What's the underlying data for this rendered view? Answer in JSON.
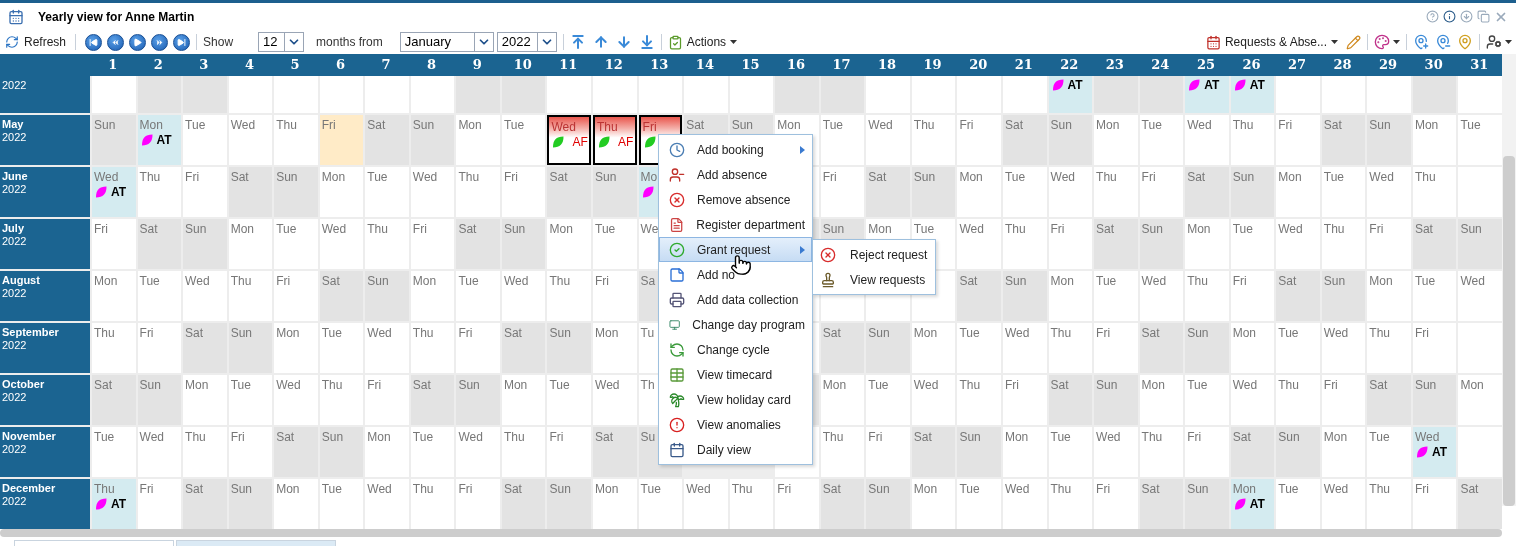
{
  "window": {
    "title": "Yearly view for Anne Martin"
  },
  "toolbar": {
    "refresh": "Refresh",
    "show": "Show",
    "months_count": "12",
    "months_from": "months from",
    "start_month": "January",
    "start_year": "2022",
    "actions": "Actions",
    "requests": "Requests & Abse..."
  },
  "day_numbers": [
    "1",
    "2",
    "3",
    "4",
    "5",
    "6",
    "7",
    "8",
    "9",
    "10",
    "11",
    "12",
    "13",
    "14",
    "15",
    "16",
    "17",
    "18",
    "19",
    "20",
    "21",
    "22",
    "23",
    "24",
    "25",
    "26",
    "27",
    "28",
    "29",
    "30",
    "31"
  ],
  "months": [
    {
      "year": "2022",
      "cells": [
        {
          "kind": "weekday"
        },
        {
          "kind": "weekend"
        },
        {
          "kind": "weekend"
        },
        {
          "kind": "weekday"
        },
        {
          "kind": "weekday"
        },
        {
          "kind": "weekday"
        },
        {
          "kind": "weekday"
        },
        {
          "kind": "weekday"
        },
        {
          "kind": "weekend"
        },
        {
          "kind": "weekend"
        },
        {
          "kind": "weekday"
        },
        {
          "kind": "weekday"
        },
        {
          "kind": "weekday"
        },
        {
          "kind": "weekday"
        },
        {
          "kind": "weekday"
        },
        {
          "kind": "weekend"
        },
        {
          "kind": "weekend"
        },
        {
          "kind": "weekday"
        },
        {
          "kind": "weekday"
        },
        {
          "kind": "weekday"
        },
        {
          "kind": "weekday"
        },
        {
          "kind": "absence",
          "badge": {
            "label": "AT",
            "color": "#ff00ff"
          }
        },
        {
          "kind": "weekend"
        },
        {
          "kind": "weekend"
        },
        {
          "kind": "absence",
          "badge": {
            "label": "AT",
            "color": "#ff00ff"
          }
        },
        {
          "kind": "absence",
          "badge": {
            "label": "AT",
            "color": "#ff00ff"
          }
        },
        {
          "kind": "weekday"
        },
        {
          "kind": "weekday"
        },
        {
          "kind": "weekday"
        },
        {
          "kind": "weekend"
        },
        {
          "kind": "empty"
        }
      ]
    },
    {
      "month": "May",
      "year": "2022",
      "cells": [
        {
          "day": "Sun",
          "kind": "weekend"
        },
        {
          "day": "Mon",
          "kind": "absence",
          "badge": {
            "label": "AT",
            "color": "#ff00ff"
          }
        },
        {
          "day": "Tue",
          "kind": "weekday"
        },
        {
          "day": "Wed",
          "kind": "weekday"
        },
        {
          "day": "Thu",
          "kind": "weekday"
        },
        {
          "day": "Fri",
          "kind": "holiday"
        },
        {
          "day": "Sat",
          "kind": "weekend"
        },
        {
          "day": "Sun",
          "kind": "weekend"
        },
        {
          "day": "Mon",
          "kind": "weekday"
        },
        {
          "day": "Tue",
          "kind": "weekday"
        },
        {
          "day": "Wed",
          "kind": "request",
          "badge": {
            "label": "AF",
            "color": "#22cc22"
          }
        },
        {
          "day": "Thu",
          "kind": "request",
          "badge": {
            "label": "AF",
            "color": "#22cc22"
          }
        },
        {
          "day": "Fri",
          "kind": "request",
          "badge": {
            "color": "#22cc22"
          }
        },
        {
          "day": "Sat",
          "kind": "weekend"
        },
        {
          "day": "Sun",
          "kind": "weekend"
        },
        {
          "day": "Mon",
          "kind": "weekday"
        },
        {
          "day": "Tue",
          "kind": "weekday"
        },
        {
          "day": "Wed",
          "kind": "weekday"
        },
        {
          "day": "Thu",
          "kind": "weekday"
        },
        {
          "day": "Fri",
          "kind": "weekday"
        },
        {
          "day": "Sat",
          "kind": "weekend"
        },
        {
          "day": "Sun",
          "kind": "weekend"
        },
        {
          "day": "Mon",
          "kind": "weekday"
        },
        {
          "day": "Tue",
          "kind": "weekday"
        },
        {
          "day": "Wed",
          "kind": "weekday"
        },
        {
          "day": "Thu",
          "kind": "weekday"
        },
        {
          "day": "Fri",
          "kind": "weekday"
        },
        {
          "day": "Sat",
          "kind": "weekend"
        },
        {
          "day": "Sun",
          "kind": "weekend"
        },
        {
          "day": "Mon",
          "kind": "weekday"
        },
        {
          "day": "Tue",
          "kind": "weekday"
        }
      ]
    },
    {
      "month": "June",
      "year": "2022",
      "cells": [
        {
          "day": "Wed",
          "kind": "absence",
          "badge": {
            "label": "AT",
            "color": "#ff00ff"
          }
        },
        {
          "day": "Thu",
          "kind": "weekday"
        },
        {
          "day": "Fri",
          "kind": "weekday"
        },
        {
          "day": "Sat",
          "kind": "weekend"
        },
        {
          "day": "Sun",
          "kind": "weekend"
        },
        {
          "day": "Mon",
          "kind": "weekday"
        },
        {
          "day": "Tue",
          "kind": "weekday"
        },
        {
          "day": "Wed",
          "kind": "weekday"
        },
        {
          "day": "Thu",
          "kind": "weekday"
        },
        {
          "day": "Fri",
          "kind": "weekday"
        },
        {
          "day": "Sat",
          "kind": "weekend"
        },
        {
          "day": "Sun",
          "kind": "weekend"
        },
        {
          "day": "Mo",
          "kind": "absence",
          "badge": {
            "color": "#ff00ff"
          }
        },
        {
          "kind": "covered"
        },
        {
          "kind": "covered"
        },
        {
          "kind": "weekday"
        },
        {
          "day": "Fri",
          "kind": "weekday"
        },
        {
          "day": "Sat",
          "kind": "weekend"
        },
        {
          "day": "Sun",
          "kind": "weekend"
        },
        {
          "day": "Mon",
          "kind": "weekday"
        },
        {
          "day": "Tue",
          "kind": "weekday"
        },
        {
          "day": "Wed",
          "kind": "weekday"
        },
        {
          "day": "Thu",
          "kind": "weekday"
        },
        {
          "day": "Fri",
          "kind": "weekday"
        },
        {
          "day": "Sat",
          "kind": "weekend"
        },
        {
          "day": "Sun",
          "kind": "weekend"
        },
        {
          "day": "Mon",
          "kind": "weekday"
        },
        {
          "day": "Tue",
          "kind": "weekday"
        },
        {
          "day": "Wed",
          "kind": "weekday"
        },
        {
          "day": "Thu",
          "kind": "weekday"
        },
        {
          "kind": "empty"
        }
      ]
    },
    {
      "month": "July",
      "year": "2022",
      "cells": [
        {
          "day": "Fri",
          "kind": "weekday"
        },
        {
          "day": "Sat",
          "kind": "weekend"
        },
        {
          "day": "Sun",
          "kind": "weekend"
        },
        {
          "day": "Mon",
          "kind": "weekday"
        },
        {
          "day": "Tue",
          "kind": "weekday"
        },
        {
          "day": "Wed",
          "kind": "weekday"
        },
        {
          "day": "Thu",
          "kind": "weekday"
        },
        {
          "day": "Fri",
          "kind": "weekday"
        },
        {
          "day": "Sat",
          "kind": "weekend"
        },
        {
          "day": "Sun",
          "kind": "weekend"
        },
        {
          "day": "Mon",
          "kind": "weekday"
        },
        {
          "day": "Tue",
          "kind": "weekday"
        },
        {
          "day": "We",
          "kind": "weekday"
        },
        {
          "kind": "covered"
        },
        {
          "kind": "covered"
        },
        {
          "kind": "weekend"
        },
        {
          "day": "Sun",
          "kind": "weekend"
        },
        {
          "day": "Mon",
          "kind": "weekday"
        },
        {
          "day": "Tue",
          "kind": "weekday"
        },
        {
          "day": "Wed",
          "kind": "weekday"
        },
        {
          "day": "Thu",
          "kind": "weekday"
        },
        {
          "day": "Fri",
          "kind": "weekday"
        },
        {
          "day": "Sat",
          "kind": "weekend"
        },
        {
          "day": "Sun",
          "kind": "weekend"
        },
        {
          "day": "Mon",
          "kind": "weekday"
        },
        {
          "day": "Tue",
          "kind": "weekday"
        },
        {
          "day": "Wed",
          "kind": "weekday"
        },
        {
          "day": "Thu",
          "kind": "weekday"
        },
        {
          "day": "Fri",
          "kind": "weekday"
        },
        {
          "day": "Sat",
          "kind": "weekend"
        },
        {
          "day": "Sun",
          "kind": "weekend"
        }
      ]
    },
    {
      "month": "August",
      "year": "2022",
      "cells": [
        {
          "day": "Mon",
          "kind": "weekday"
        },
        {
          "day": "Tue",
          "kind": "weekday"
        },
        {
          "day": "Wed",
          "kind": "weekday"
        },
        {
          "day": "Thu",
          "kind": "weekday"
        },
        {
          "day": "Fri",
          "kind": "weekday"
        },
        {
          "day": "Sat",
          "kind": "weekend"
        },
        {
          "day": "Sun",
          "kind": "weekend"
        },
        {
          "day": "Mon",
          "kind": "weekday"
        },
        {
          "day": "Tue",
          "kind": "weekday"
        },
        {
          "day": "Wed",
          "kind": "weekday"
        },
        {
          "day": "Thu",
          "kind": "weekday"
        },
        {
          "day": "Fri",
          "kind": "weekday"
        },
        {
          "day": "Sa",
          "kind": "weekend"
        },
        {
          "kind": "covered"
        },
        {
          "kind": "covered"
        },
        {
          "kind": "weekday"
        },
        {
          "kind": "weekday"
        },
        {
          "kind": "weekday"
        },
        {
          "kind": "weekday"
        },
        {
          "day": "Sat",
          "kind": "weekend"
        },
        {
          "day": "Sun",
          "kind": "weekend"
        },
        {
          "day": "Mon",
          "kind": "weekday"
        },
        {
          "day": "Tue",
          "kind": "weekday"
        },
        {
          "day": "Wed",
          "kind": "weekday"
        },
        {
          "day": "Thu",
          "kind": "weekday"
        },
        {
          "day": "Fri",
          "kind": "weekday"
        },
        {
          "day": "Sat",
          "kind": "weekend"
        },
        {
          "day": "Sun",
          "kind": "weekend"
        },
        {
          "day": "Mon",
          "kind": "weekday"
        },
        {
          "day": "Tue",
          "kind": "weekday"
        },
        {
          "day": "Wed",
          "kind": "weekday"
        }
      ]
    },
    {
      "month": "September",
      "year": "2022",
      "cells": [
        {
          "day": "Thu",
          "kind": "weekday"
        },
        {
          "day": "Fri",
          "kind": "weekday"
        },
        {
          "day": "Sat",
          "kind": "weekend"
        },
        {
          "day": "Sun",
          "kind": "weekend"
        },
        {
          "day": "Mon",
          "kind": "weekday"
        },
        {
          "day": "Tue",
          "kind": "weekday"
        },
        {
          "day": "Wed",
          "kind": "weekday"
        },
        {
          "day": "Thu",
          "kind": "weekday"
        },
        {
          "day": "Fri",
          "kind": "weekday"
        },
        {
          "day": "Sat",
          "kind": "weekend"
        },
        {
          "day": "Sun",
          "kind": "weekend"
        },
        {
          "day": "Mon",
          "kind": "weekday"
        },
        {
          "day": "Tu",
          "kind": "weekday"
        },
        {
          "kind": "covered"
        },
        {
          "kind": "covered"
        },
        {
          "kind": "weekday"
        },
        {
          "day": "Sat",
          "kind": "weekend"
        },
        {
          "day": "Sun",
          "kind": "weekend"
        },
        {
          "day": "Mon",
          "kind": "weekday"
        },
        {
          "day": "Tue",
          "kind": "weekday"
        },
        {
          "day": "Wed",
          "kind": "weekday"
        },
        {
          "day": "Thu",
          "kind": "weekday"
        },
        {
          "day": "Fri",
          "kind": "weekday"
        },
        {
          "day": "Sat",
          "kind": "weekend"
        },
        {
          "day": "Sun",
          "kind": "weekend"
        },
        {
          "day": "Mon",
          "kind": "weekday"
        },
        {
          "day": "Tue",
          "kind": "weekday"
        },
        {
          "day": "Wed",
          "kind": "weekday"
        },
        {
          "day": "Thu",
          "kind": "weekday"
        },
        {
          "day": "Fri",
          "kind": "weekday"
        },
        {
          "kind": "empty"
        }
      ]
    },
    {
      "month": "October",
      "year": "2022",
      "cells": [
        {
          "day": "Sat",
          "kind": "weekend"
        },
        {
          "day": "Sun",
          "kind": "weekend"
        },
        {
          "day": "Mon",
          "kind": "weekday"
        },
        {
          "day": "Tue",
          "kind": "weekday"
        },
        {
          "day": "Wed",
          "kind": "weekday"
        },
        {
          "day": "Thu",
          "kind": "weekday"
        },
        {
          "day": "Fri",
          "kind": "weekday"
        },
        {
          "day": "Sat",
          "kind": "weekend"
        },
        {
          "day": "Sun",
          "kind": "weekend"
        },
        {
          "day": "Mon",
          "kind": "weekday"
        },
        {
          "day": "Tue",
          "kind": "weekday"
        },
        {
          "day": "Wed",
          "kind": "weekday"
        },
        {
          "day": "Th",
          "kind": "weekday"
        },
        {
          "kind": "covered"
        },
        {
          "kind": "covered"
        },
        {
          "kind": "weekend"
        },
        {
          "day": "Mon",
          "kind": "weekday"
        },
        {
          "day": "Tue",
          "kind": "weekday"
        },
        {
          "day": "Wed",
          "kind": "weekday"
        },
        {
          "day": "Thu",
          "kind": "weekday"
        },
        {
          "day": "Fri",
          "kind": "weekday"
        },
        {
          "day": "Sat",
          "kind": "weekend"
        },
        {
          "day": "Sun",
          "kind": "weekend"
        },
        {
          "day": "Mon",
          "kind": "weekday"
        },
        {
          "day": "Tue",
          "kind": "weekday"
        },
        {
          "day": "Wed",
          "kind": "weekday"
        },
        {
          "day": "Thu",
          "kind": "weekday"
        },
        {
          "day": "Fri",
          "kind": "weekday"
        },
        {
          "day": "Sat",
          "kind": "weekend"
        },
        {
          "day": "Sun",
          "kind": "weekend"
        },
        {
          "day": "Mon",
          "kind": "weekday"
        }
      ]
    },
    {
      "month": "November",
      "year": "2022",
      "cells": [
        {
          "day": "Tue",
          "kind": "weekday"
        },
        {
          "day": "Wed",
          "kind": "weekday"
        },
        {
          "day": "Thu",
          "kind": "weekday"
        },
        {
          "day": "Fri",
          "kind": "weekday"
        },
        {
          "day": "Sat",
          "kind": "weekend"
        },
        {
          "day": "Sun",
          "kind": "weekend"
        },
        {
          "day": "Mon",
          "kind": "weekday"
        },
        {
          "day": "Tue",
          "kind": "weekday"
        },
        {
          "day": "Wed",
          "kind": "weekday"
        },
        {
          "day": "Thu",
          "kind": "weekday"
        },
        {
          "day": "Fri",
          "kind": "weekday"
        },
        {
          "day": "Sat",
          "kind": "weekend"
        },
        {
          "day": "Su",
          "kind": "weekend"
        },
        {
          "kind": "covered"
        },
        {
          "kind": "covered"
        },
        {
          "kind": "weekday"
        },
        {
          "day": "Thu",
          "kind": "weekday"
        },
        {
          "day": "Fri",
          "kind": "weekday"
        },
        {
          "day": "Sat",
          "kind": "weekend"
        },
        {
          "day": "Sun",
          "kind": "weekend"
        },
        {
          "day": "Mon",
          "kind": "weekday"
        },
        {
          "day": "Tue",
          "kind": "weekday"
        },
        {
          "day": "Wed",
          "kind": "weekday"
        },
        {
          "day": "Thu",
          "kind": "weekday"
        },
        {
          "day": "Fri",
          "kind": "weekday"
        },
        {
          "day": "Sat",
          "kind": "weekend"
        },
        {
          "day": "Sun",
          "kind": "weekend"
        },
        {
          "day": "Mon",
          "kind": "weekday"
        },
        {
          "day": "Tue",
          "kind": "weekday"
        },
        {
          "day": "Wed",
          "kind": "absence",
          "badge": {
            "label": "AT",
            "color": "#ff00ff"
          }
        },
        {
          "kind": "empty"
        }
      ]
    },
    {
      "month": "December",
      "year": "2022",
      "cells": [
        {
          "day": "Thu",
          "kind": "absence",
          "badge": {
            "label": "AT",
            "color": "#ff00ff"
          }
        },
        {
          "day": "Fri",
          "kind": "weekday"
        },
        {
          "day": "Sat",
          "kind": "weekend"
        },
        {
          "day": "Sun",
          "kind": "weekend"
        },
        {
          "day": "Mon",
          "kind": "weekday"
        },
        {
          "day": "Tue",
          "kind": "weekday"
        },
        {
          "day": "Wed",
          "kind": "weekday"
        },
        {
          "day": "Thu",
          "kind": "weekday"
        },
        {
          "day": "Fri",
          "kind": "weekday"
        },
        {
          "day": "Sat",
          "kind": "weekend"
        },
        {
          "day": "Sun",
          "kind": "weekend"
        },
        {
          "day": "Mon",
          "kind": "weekday"
        },
        {
          "day": "Tue",
          "kind": "weekday"
        },
        {
          "day": "Wed",
          "kind": "weekday"
        },
        {
          "day": "Thu",
          "kind": "weekday"
        },
        {
          "day": "Fri",
          "kind": "weekday"
        },
        {
          "day": "Sat",
          "kind": "weekend"
        },
        {
          "day": "Sun",
          "kind": "weekend"
        },
        {
          "day": "Mon",
          "kind": "weekday"
        },
        {
          "day": "Tue",
          "kind": "weekday"
        },
        {
          "day": "Wed",
          "kind": "weekday"
        },
        {
          "day": "Thu",
          "kind": "weekday"
        },
        {
          "day": "Fri",
          "kind": "weekday"
        },
        {
          "day": "Sat",
          "kind": "weekend"
        },
        {
          "day": "Sun",
          "kind": "weekend"
        },
        {
          "day": "Mon",
          "kind": "absence",
          "badge": {
            "label": "AT",
            "color": "#ff00ff"
          }
        },
        {
          "day": "Tue",
          "kind": "weekday"
        },
        {
          "day": "Wed",
          "kind": "weekday"
        },
        {
          "day": "Thu",
          "kind": "weekday"
        },
        {
          "day": "Fri",
          "kind": "weekday"
        },
        {
          "day": "Sat",
          "kind": "weekend"
        }
      ]
    }
  ],
  "context_menu": [
    {
      "label": "Add booking",
      "has_submenu": true,
      "selected": false
    },
    {
      "label": "Add absence",
      "has_submenu": false,
      "selected": false
    },
    {
      "label": "Remove absence",
      "has_submenu": false,
      "selected": false
    },
    {
      "label": "Register department",
      "has_submenu": false,
      "selected": false
    },
    {
      "label": "Grant request",
      "has_submenu": true,
      "selected": true
    },
    {
      "label": "Add no",
      "has_submenu": false,
      "selected": false
    },
    {
      "label": "Add data collection",
      "has_submenu": false,
      "selected": false
    },
    {
      "label": "Change day program",
      "has_submenu": false,
      "selected": false
    },
    {
      "label": "Change cycle",
      "has_submenu": false,
      "selected": false
    },
    {
      "label": "View timecard",
      "has_submenu": false,
      "selected": false
    },
    {
      "label": "View holiday card",
      "has_submenu": false,
      "selected": false
    },
    {
      "label": "View anomalies",
      "has_submenu": false,
      "selected": false
    },
    {
      "label": "Daily view",
      "has_submenu": false,
      "selected": false
    }
  ],
  "submenu": [
    {
      "label": "Reject request"
    },
    {
      "label": "View requests"
    }
  ],
  "bottom_tabs": [
    {
      "selected": false
    },
    {
      "selected": true
    }
  ]
}
